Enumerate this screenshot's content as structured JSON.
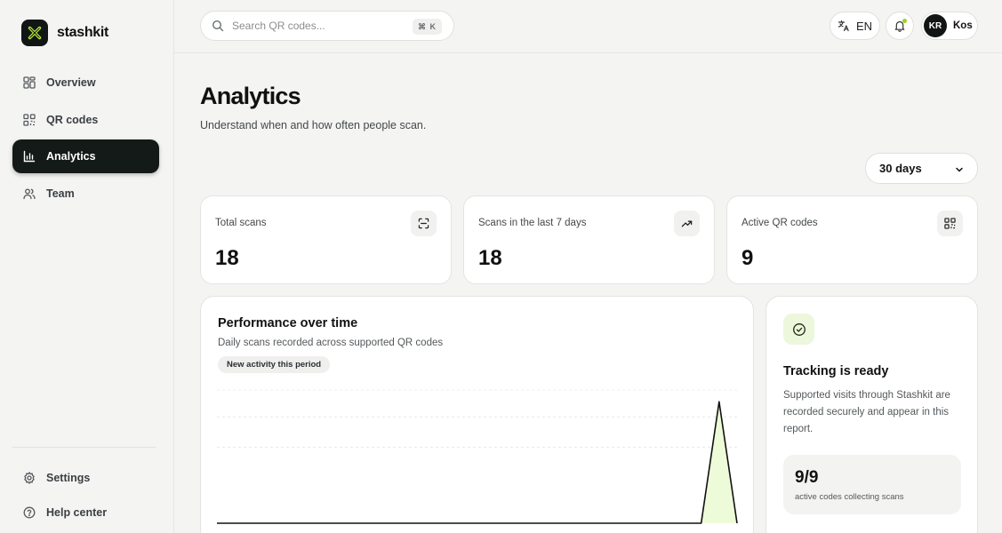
{
  "brand": {
    "name": "stashkit"
  },
  "sidebar": {
    "items": [
      {
        "label": "Overview",
        "icon": "grid-icon",
        "active": false
      },
      {
        "label": "QR codes",
        "icon": "qr-code-icon",
        "active": false
      },
      {
        "label": "Analytics",
        "icon": "bar-chart-icon",
        "active": true
      },
      {
        "label": "Team",
        "icon": "users-icon",
        "active": false
      }
    ],
    "bottom": [
      {
        "label": "Settings",
        "icon": "gear-icon"
      },
      {
        "label": "Help center",
        "icon": "help-circle-icon"
      }
    ]
  },
  "header": {
    "search_placeholder": "Search QR codes...",
    "search_shortcut": "⌘ K",
    "language": "EN",
    "user": {
      "initials": "KR",
      "name": "Kos"
    },
    "notification_dot_color": "#9ad12b"
  },
  "page": {
    "title": "Analytics",
    "subtitle": "Understand when and how often people scan.",
    "range": "30 days"
  },
  "stats": [
    {
      "label": "Total scans",
      "value": "18",
      "icon": "scan-icon"
    },
    {
      "label": "Scans in the last 7 days",
      "value": "18",
      "icon": "trending-up-icon"
    },
    {
      "label": "Active QR codes",
      "value": "9",
      "icon": "qr-code-icon"
    }
  ],
  "performance": {
    "title": "Performance over time",
    "subtitle": "Daily scans recorded across supported QR codes",
    "badge": "New activity this period"
  },
  "chart_data": {
    "type": "area",
    "x": [
      1,
      2,
      3,
      4,
      5,
      6,
      7,
      8,
      9,
      10,
      11,
      12,
      13,
      14,
      15,
      16,
      17,
      18,
      19,
      20,
      21,
      22,
      23,
      24,
      25,
      26,
      27,
      28,
      29,
      30
    ],
    "series": [
      {
        "values": [
          0,
          0,
          0,
          0,
          0,
          0,
          0,
          0,
          0,
          0,
          0,
          0,
          0,
          0,
          0,
          0,
          0,
          0,
          0,
          0,
          0,
          0,
          0,
          0,
          0,
          0,
          0,
          0,
          18,
          0
        ]
      }
    ],
    "ylim": [
      0,
      20
    ],
    "grid": true,
    "line_color": "#111111",
    "fill_color": "#eefbd8"
  },
  "tracking": {
    "title": "Tracking is ready",
    "body": "Supported visits through Stashkit are recorded securely and appear in this report.",
    "count": "9/9",
    "caption": "active codes collecting scans"
  },
  "colors": {
    "accent": "#9ad12b",
    "dark": "#141a17"
  }
}
